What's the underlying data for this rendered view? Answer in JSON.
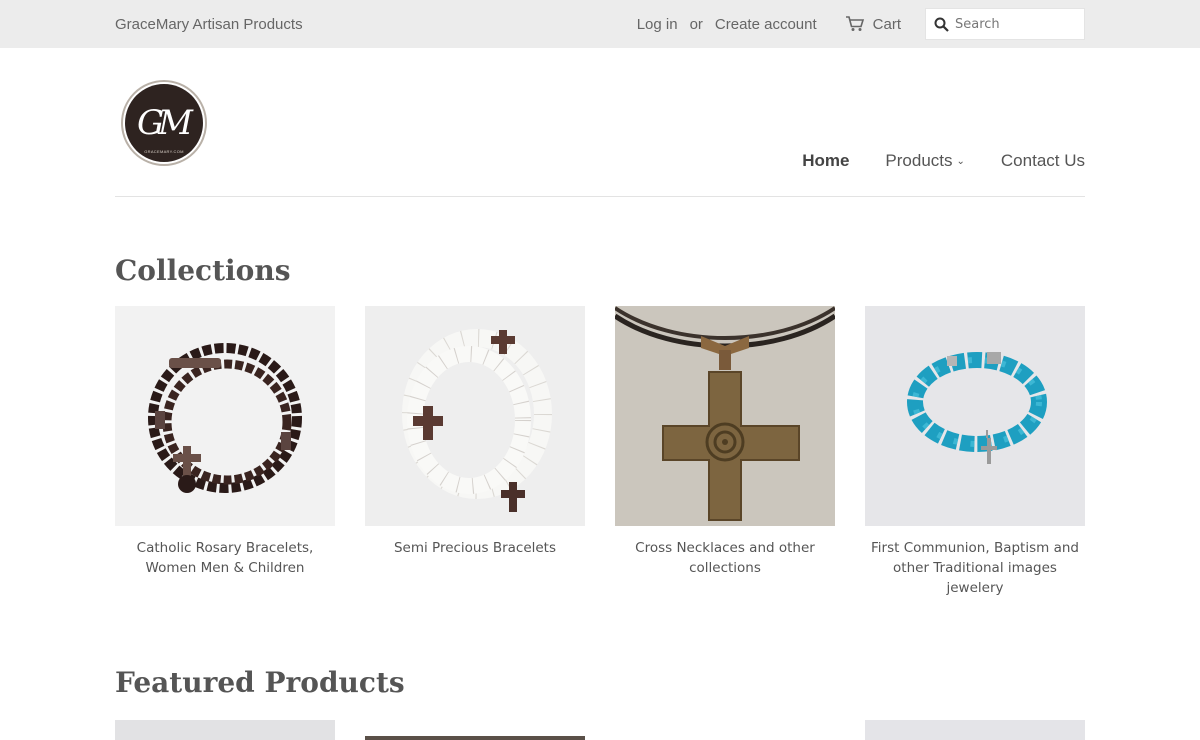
{
  "topbar": {
    "shop_name": "GraceMary Artisan Products",
    "login": "Log in",
    "or": "or",
    "create_account": "Create account",
    "cart": "Cart",
    "search_placeholder": "Search"
  },
  "logo": {
    "text": "GM",
    "sub": "GRACEMARY.COM"
  },
  "nav": {
    "home": "Home",
    "products": "Products",
    "contact": "Contact Us"
  },
  "collections": {
    "title": "Collections",
    "items": [
      {
        "label": "Catholic Rosary Bracelets, Women Men & Children",
        "icon": "rosary-bracelet-image"
      },
      {
        "label": "Semi Precious Bracelets",
        "icon": "white-bead-bracelet-image"
      },
      {
        "label": "Cross Necklaces and other collections",
        "icon": "cross-necklace-image"
      },
      {
        "label": "First Communion, Baptism and other Traditional images jewelery",
        "icon": "turquoise-bracelet-image"
      }
    ]
  },
  "featured": {
    "title": "Featured Products"
  },
  "colors": {
    "topbar_bg": "#ececec",
    "text": "#555555",
    "divider": "#e3e3e3"
  }
}
